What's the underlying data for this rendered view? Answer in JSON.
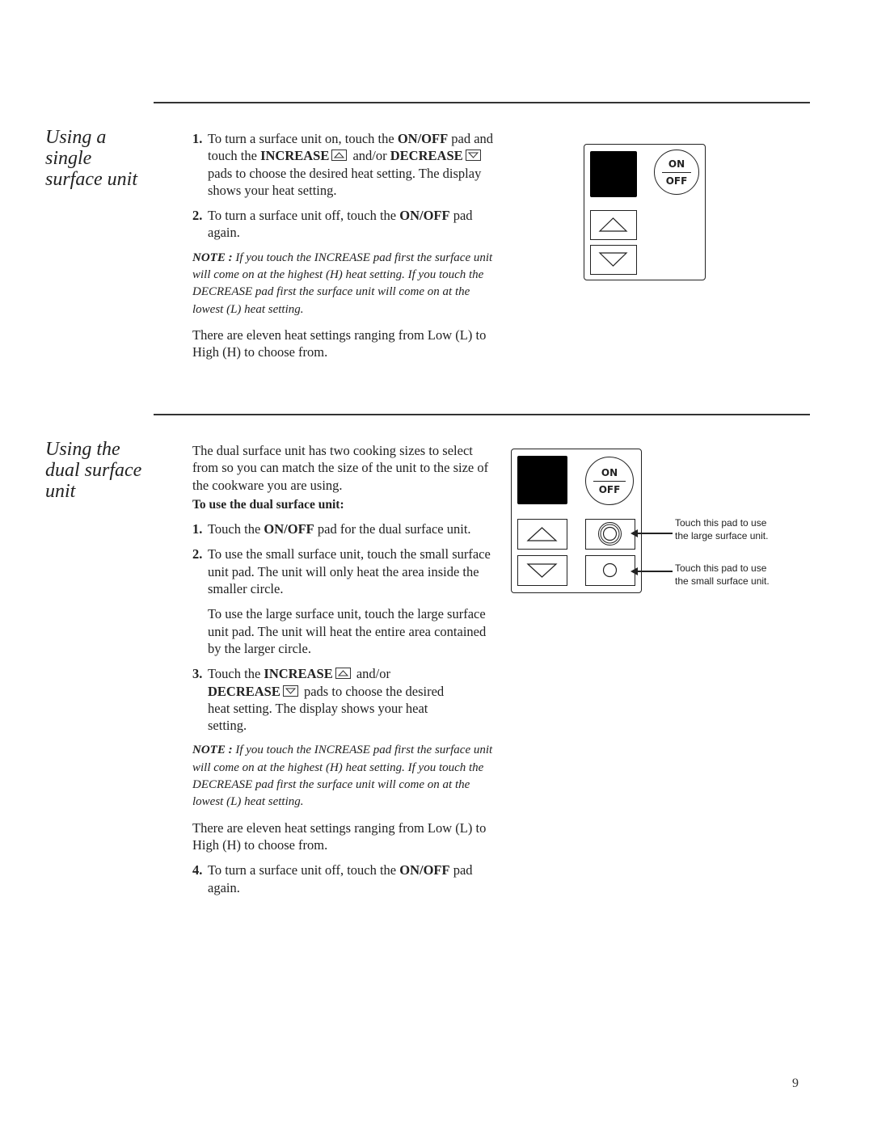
{
  "section1": {
    "title": "Using a single surface unit",
    "title_lines": [
      "Using a",
      "single",
      "surface unit"
    ],
    "steps": [
      {
        "num": "1.",
        "text_a": "To turn a surface unit on, touch the",
        "bold_onoff": "ON/OFF",
        "text_b": "pad and touch the",
        "bold_increase": "INCREASE",
        "text_c": "and/or",
        "bold_decrease": "DECREASE",
        "text_d": "pads to choose the desired heat setting. The display shows your heat setting."
      },
      {
        "num": "2.",
        "text_a": "To turn a surface unit off, touch the",
        "bold_onoff": "ON/OFF",
        "text_b": "pad again."
      }
    ],
    "note_label": "NOTE :",
    "note_text": "If you touch the INCREASE pad first the surface unit will come on at the highest (H) heat setting. If you touch the DECREASE pad first the surface unit will come on at the lowest (L) heat setting.",
    "settings_text": "There are eleven heat settings ranging from Low (L) to High (H) to choose from.",
    "panel": {
      "on_label": "ON",
      "off_label": "OFF"
    }
  },
  "section2": {
    "title_lines": [
      "Using the",
      "dual surface",
      "unit"
    ],
    "intro": "The dual surface unit has two cooking sizes to select from so you can match the size of the unit to the size of the cookware you are using.",
    "subhead": "To use the dual surface unit:",
    "step1": {
      "num": "1.",
      "text_a": "Touch the",
      "bold_onoff": "ON/OFF",
      "text_b": "pad for the dual surface unit."
    },
    "step2": {
      "num": "2.",
      "text": "To use the small surface unit, touch the small surface unit pad. The unit will only heat the area inside the smaller circle.",
      "text_large": "To use the large surface unit, touch the large surface unit pad. The unit will heat the entire area contained by the larger circle."
    },
    "step3": {
      "num": "3.",
      "text_a": "Touch the",
      "bold_increase": "INCREASE",
      "text_b": "and/or",
      "bold_decrease": "DECREASE",
      "text_c": "pads to choose the desired heat setting. The display shows your heat setting."
    },
    "note_label": "NOTE :",
    "note_text": "If you touch the INCREASE pad first the surface unit will come on at the highest (H) heat setting. If you touch the DECREASE pad first the surface unit will come on at the lowest (L) heat setting.",
    "settings_text": "There are eleven heat settings ranging from Low (L) to High (H) to choose from.",
    "step4": {
      "num": "4.",
      "text_a": "To turn a surface unit off, touch the",
      "bold_onoff": "ON/OFF",
      "text_b": "pad again."
    },
    "panel": {
      "on_label": "ON",
      "off_label": "OFF",
      "callout_large": [
        "Touch this pad to use",
        "the large surface unit."
      ],
      "callout_small": [
        "Touch this pad to use",
        "the small surface unit."
      ]
    }
  },
  "page_number": "9"
}
